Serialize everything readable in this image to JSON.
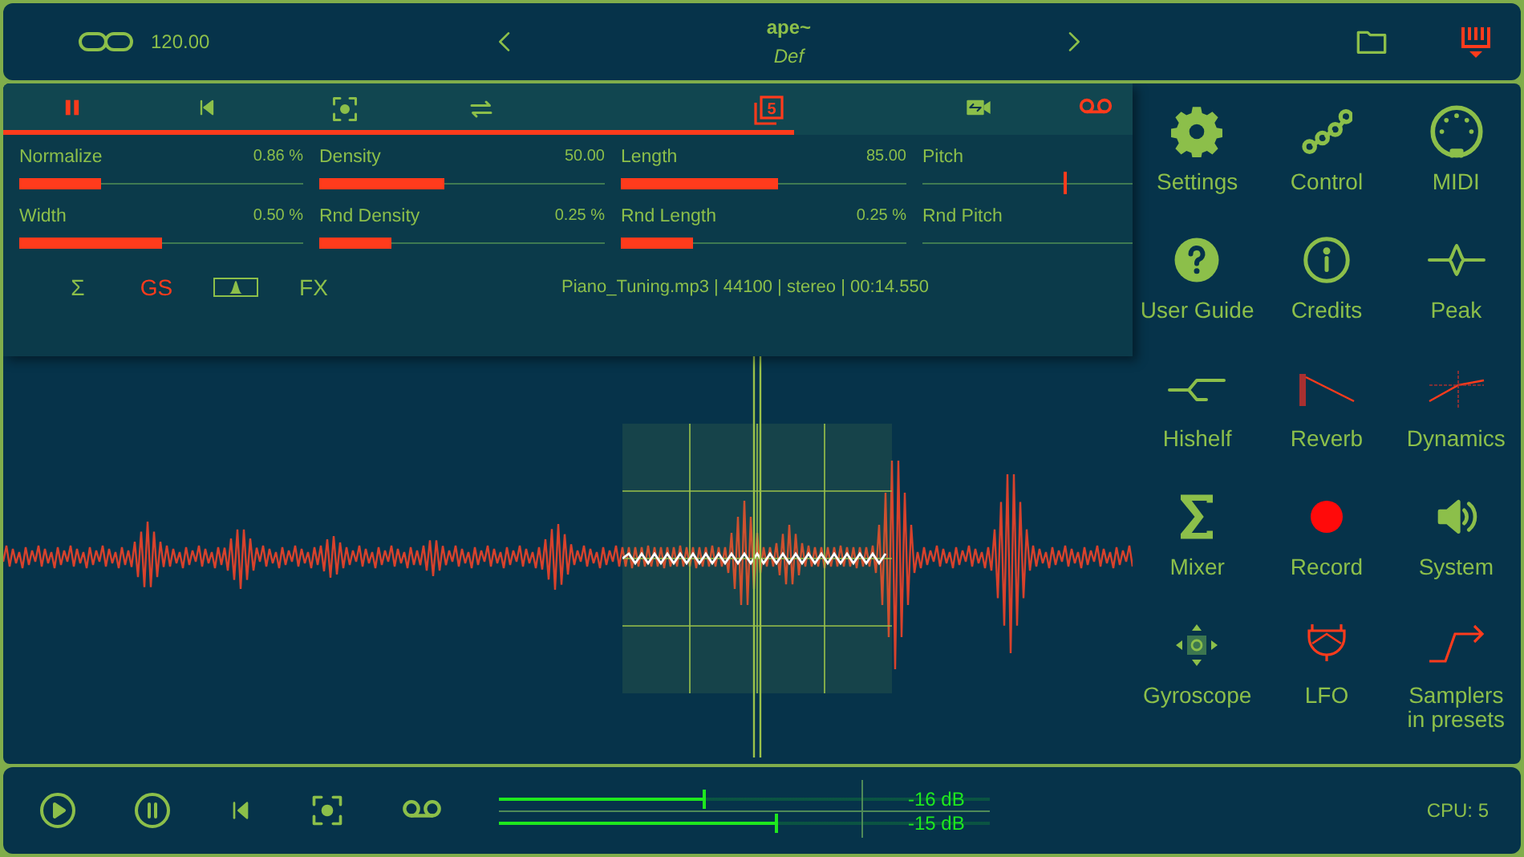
{
  "top_bar": {
    "tempo": "120.00",
    "title": "ape~",
    "subtitle": "Def"
  },
  "toolbar": {
    "level": 0.7,
    "buttons": [
      {
        "kind": "pause",
        "active": true
      },
      {
        "kind": "skip-back",
        "active": false
      },
      {
        "kind": "capture",
        "active": false
      },
      {
        "kind": "loop",
        "active": false
      },
      {
        "kind": "layers",
        "active": true,
        "label": "5"
      },
      {
        "kind": "swap",
        "active": false
      },
      {
        "kind": "tape",
        "active": true
      }
    ]
  },
  "sliders": [
    {
      "name": "Normalize",
      "reading": "0.86 %",
      "kind": "fill",
      "level": 0.29
    },
    {
      "name": "Density",
      "reading": "50.00",
      "kind": "fill",
      "level": 0.44
    },
    {
      "name": "Length",
      "reading": "85.00",
      "kind": "fill",
      "level": 0.55
    },
    {
      "name": "Pitch",
      "kind": "marker",
      "level": 0.67
    },
    {
      "name": "Width",
      "reading": "0.50 %",
      "kind": "fill",
      "level": 0.5
    },
    {
      "name": "Rnd Density",
      "reading": "0.25 %",
      "kind": "fill",
      "level": 0.25
    },
    {
      "name": "Rnd Length",
      "reading": "0.25 %",
      "kind": "fill",
      "level": 0.25
    },
    {
      "name": "Rnd Pitch",
      "kind": "plain"
    }
  ],
  "modes": [
    {
      "kind": "sum",
      "label": "Σ",
      "active": false
    },
    {
      "kind": "text",
      "label": "GS",
      "active": true
    },
    {
      "kind": "envelope",
      "active": false
    },
    {
      "kind": "text",
      "label": "FX",
      "active": false
    }
  ],
  "file_info": "Piano_Tuning.mp3 | 44100 | stereo  | 00:14.550",
  "menu": [
    {
      "kind": "gear",
      "label": "Settings"
    },
    {
      "kind": "nodes",
      "label": "Control"
    },
    {
      "kind": "midi",
      "label": "MIDI"
    },
    {
      "kind": "help",
      "label": "User Guide"
    },
    {
      "kind": "info",
      "label": "Credits"
    },
    {
      "kind": "peak",
      "label": "Peak"
    },
    {
      "kind": "hishelf",
      "label": "Hishelf"
    },
    {
      "kind": "reverb",
      "label": "Reverb"
    },
    {
      "kind": "dynamics",
      "label": "Dynamics"
    },
    {
      "kind": "sigma",
      "label": "Mixer"
    },
    {
      "kind": "record",
      "label": "Record"
    },
    {
      "kind": "speaker",
      "label": "System"
    },
    {
      "kind": "gyro",
      "label": "Gyroscope"
    },
    {
      "kind": "lfo",
      "label": "LFO"
    },
    {
      "kind": "sampler",
      "label": "Samplers in presets"
    }
  ],
  "transport": [
    {
      "kind": "play"
    },
    {
      "kind": "pause"
    },
    {
      "kind": "skip-back"
    },
    {
      "kind": "capture"
    },
    {
      "kind": "tape"
    }
  ],
  "meters": [
    {
      "level": 0.42,
      "reading": "-16 dB"
    },
    {
      "level": 0.57,
      "reading": "-15 dB"
    }
  ],
  "cpu": "CPU: 5"
}
